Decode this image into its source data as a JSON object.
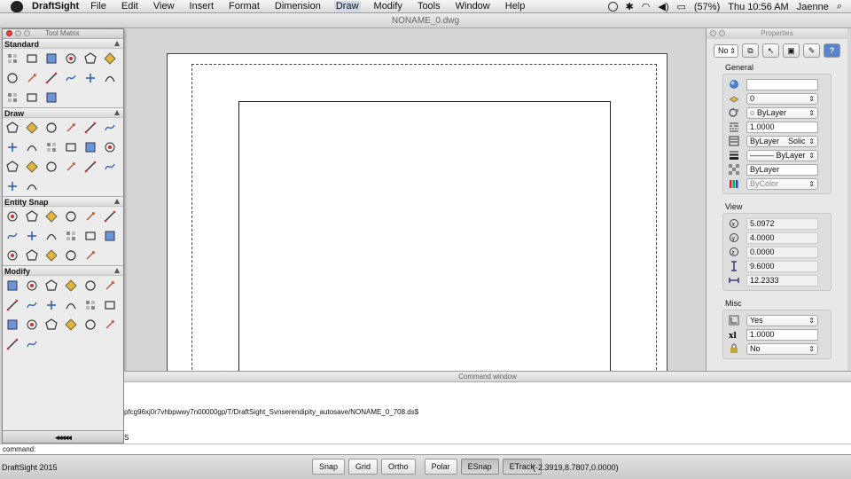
{
  "menubar": {
    "app_name": "DraftSight",
    "menus": [
      "File",
      "Edit",
      "View",
      "Insert",
      "Format",
      "Dimension",
      "Draw",
      "Modify",
      "Tools",
      "Window",
      "Help"
    ],
    "battery": "(57%)",
    "clock": "Thu 10:56 AM",
    "user": "Jaenne"
  },
  "window": {
    "title": "NONAME_0.dwg"
  },
  "tool_matrix": {
    "title": "Tool Matrix",
    "sections": {
      "standard": {
        "label": "Standard",
        "icons": [
          "new-icon",
          "open-icon",
          "save-icon",
          "print-icon",
          "print-preview-icon",
          "cut-icon",
          "copy-icon",
          "paste-icon",
          "pencil-icon",
          "undo-icon",
          "redo-icon",
          "pan-icon",
          "zoom-icon",
          "zoom-window-icon",
          "text-style-icon"
        ]
      },
      "draw": {
        "label": "Draw",
        "icons": [
          "line-icon",
          "infinite-line-icon",
          "polygon-icon",
          "rectangle-icon",
          "arc-icon",
          "polyline-icon",
          "circle-icon",
          "spline-icon",
          "cloud-icon",
          "point-icon",
          "wave-icon",
          "hatch-icon",
          "block-icon",
          "insert-block-icon",
          "table-icon",
          "region-icon",
          "gradient-icon",
          "boundary-icon",
          "donut-icon",
          "revision-cloud-icon"
        ]
      },
      "entity_snap": {
        "label": "Entity Snap",
        "icons": [
          "snap-endpoint-icon",
          "snap-midpoint-icon",
          "snap-intersection-icon",
          "snap-apparent-icon",
          "snap-extension-icon",
          "snap-perpendicular-icon",
          "snap-parallel-icon",
          "snap-center-icon",
          "snap-quadrant-icon",
          "snap-tangent-icon",
          "snap-insertion-icon",
          "snap-node-icon",
          "snap-nearest-icon",
          "snap-none-icon",
          "snap-angle-icon",
          "snap-from-icon",
          "snap-settings-icon"
        ]
      },
      "modify": {
        "label": "Modify",
        "icons": [
          "erase-icon",
          "copy-entity-icon",
          "mirror-icon",
          "offset-icon",
          "pattern-icon",
          "rotate-icon",
          "scale-icon",
          "stretch-icon",
          "trim-icon",
          "extend-icon",
          "fillet-icon",
          "chamfer-icon",
          "break-icon",
          "join-icon",
          "t-split-icon",
          "explode-icon",
          "edit-polyline-icon",
          "align-icon",
          "move-icon",
          "explode-block-icon"
        ]
      }
    },
    "footer": "◂◂◂◂◂"
  },
  "properties": {
    "title": "Properties",
    "selection": "No",
    "general": {
      "label": "General",
      "color": "",
      "layer": "0",
      "linetype_scale_combo": "ByLayer",
      "linetype_scale": "1.0000",
      "line_style": "ByLayer",
      "line_style_suffix": "Solic",
      "line_weight": "ByLayer",
      "transparency": "ByLayer",
      "plot_style": "ByColor"
    },
    "view": {
      "label": "View",
      "center_x": "5.0972",
      "center_y": "4.0000",
      "center_z": "0.0000",
      "height": "9.6000",
      "width": "12.2333"
    },
    "misc": {
      "label": "Misc",
      "ucs_icon": "Yes",
      "annotation_scale": "1.0000",
      "lock": "No"
    }
  },
  "command_window": {
    "title": "Command window",
    "line1": "pfcg96xj0r7vhbpwwy7n00000gp/T/DraftSight_Svnserendipity_autosave/NONAME_0_708.ds$",
    "line2": "S",
    "prompt": "command:"
  },
  "statusbar": {
    "app": "DraftSight 2015",
    "buttons": [
      "Snap",
      "Grid",
      "Ortho",
      "Polar",
      "ESnap",
      "ETrack"
    ],
    "active": [
      "ESnap",
      "ETrack"
    ],
    "coords": "(-2.3919,8.7807,0.0000)"
  }
}
